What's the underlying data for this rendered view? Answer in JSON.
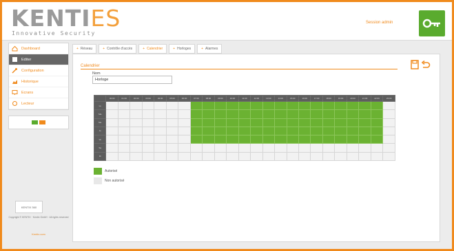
{
  "header": {
    "brand_main": "KENTI",
    "brand_accent": "ES",
    "brand_sub": "Innovative Security",
    "user_link": "Session admin",
    "logout_label": "Quitter"
  },
  "sidebar": {
    "items": [
      {
        "label": "Dashboard",
        "icon": "home-icon",
        "active": false
      },
      {
        "label": "Editer",
        "icon": "edit-icon",
        "active": true
      },
      {
        "label": "Configuration",
        "icon": "wrench-icon",
        "active": false
      },
      {
        "label": "Historique",
        "icon": "chart-icon",
        "active": false
      },
      {
        "label": "Ecrans",
        "icon": "monitor-icon",
        "active": false
      },
      {
        "label": "Lecteur",
        "icon": "reader-icon",
        "active": false
      }
    ],
    "footer": {
      "logo_text": "KENTIX 360",
      "copyright": "Copyright © KENTIX · Kentix GmbH · All rights reserved",
      "link": "Kentix.com"
    }
  },
  "tabs": [
    {
      "label": "Réseau",
      "active": false
    },
    {
      "label": "Contrôle d'accès",
      "active": false
    },
    {
      "label": "Calendrier",
      "active": true
    },
    {
      "label": "Horloges",
      "active": false
    },
    {
      "label": "Alarmes",
      "active": false
    }
  ],
  "panel": {
    "title": "Calendrier",
    "name_label": "Nom",
    "name_value": "Horloge"
  },
  "schedule": {
    "hours": [
      "00:00",
      "01:00",
      "02:00",
      "03:00",
      "04:00",
      "05:00",
      "06:00",
      "07:00",
      "08:00",
      "09:00",
      "10:00",
      "11:00",
      "12:00",
      "13:00",
      "14:00",
      "15:00",
      "16:00",
      "17:00",
      "18:00",
      "19:00",
      "20:00",
      "21:00",
      "22:00",
      "23:00"
    ],
    "days": [
      {
        "label": "Lu",
        "active_from": 7,
        "active_to": 22
      },
      {
        "label": "Ma",
        "active_from": 7,
        "active_to": 22
      },
      {
        "label": "Me",
        "active_from": 7,
        "active_to": 22
      },
      {
        "label": "Je",
        "active_from": 7,
        "active_to": 22
      },
      {
        "label": "Ve",
        "active_from": 7,
        "active_to": 22
      },
      {
        "label": "Sa",
        "active_from": -1,
        "active_to": -1
      },
      {
        "label": "Di",
        "active_from": -1,
        "active_to": -1
      }
    ]
  },
  "legend": {
    "on_label": "Autorisé",
    "off_label": "Non autorisé"
  },
  "colors": {
    "accent": "#f08a1c",
    "active_cell": "#6bb232",
    "inactive_cell": "#f2f2f2",
    "header_dark": "#5d5d5d"
  }
}
